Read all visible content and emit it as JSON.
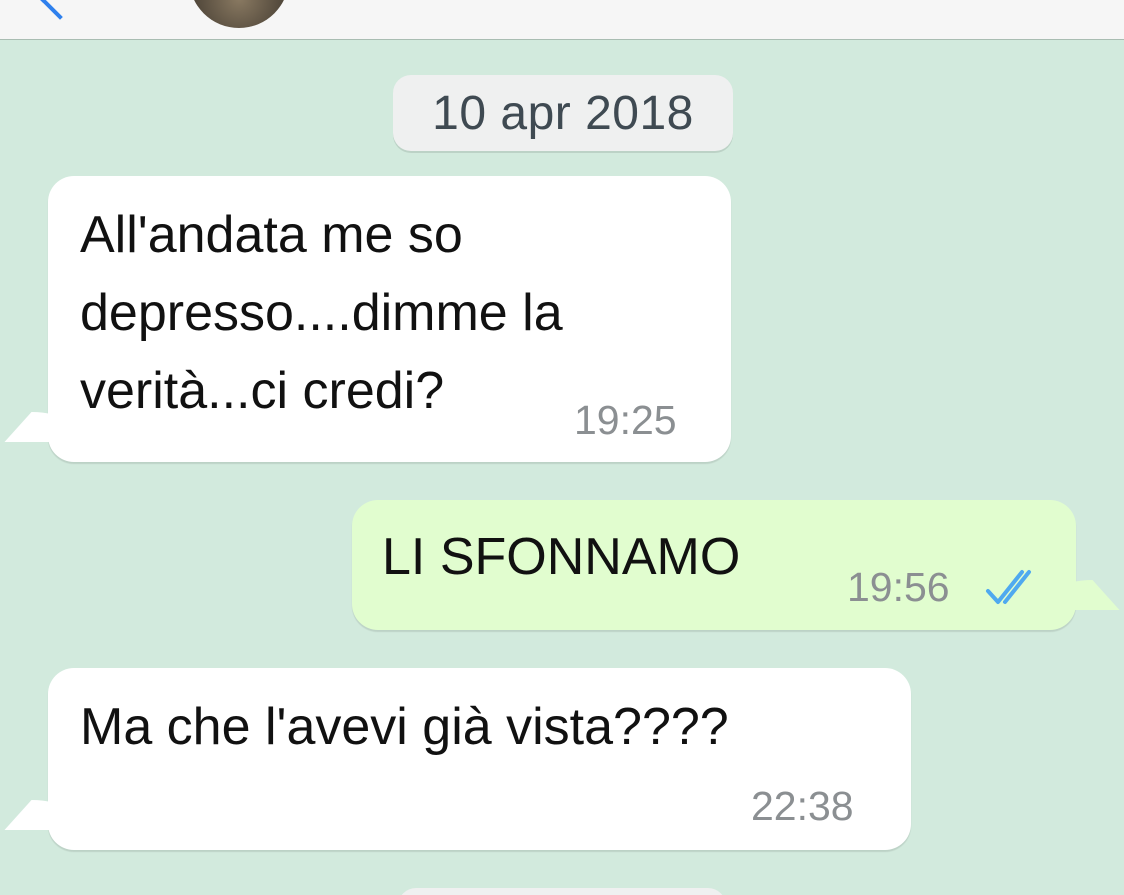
{
  "header": {
    "back_icon": "chevron-left-icon",
    "avatar_icon": "contact-avatar"
  },
  "chat": {
    "date_separator": "10 apr 2018",
    "messages": [
      {
        "direction": "incoming",
        "text": "All'andata me so\ndepresso....dimme la\nverità...ci credi?",
        "time": "19:25"
      },
      {
        "direction": "outgoing",
        "text": "LI SFONNAMO",
        "time": "19:56",
        "status_icon": "double-check-read-icon",
        "status_color": "#4fa9ef"
      },
      {
        "direction": "incoming",
        "text": "Ma che l'avevi già vista????",
        "time": "22:38"
      }
    ]
  },
  "colors": {
    "chat_background": "#d2eadd",
    "incoming_bubble": "#ffffff",
    "outgoing_bubble": "#e1fdcf",
    "accent": "#2f80ed"
  }
}
